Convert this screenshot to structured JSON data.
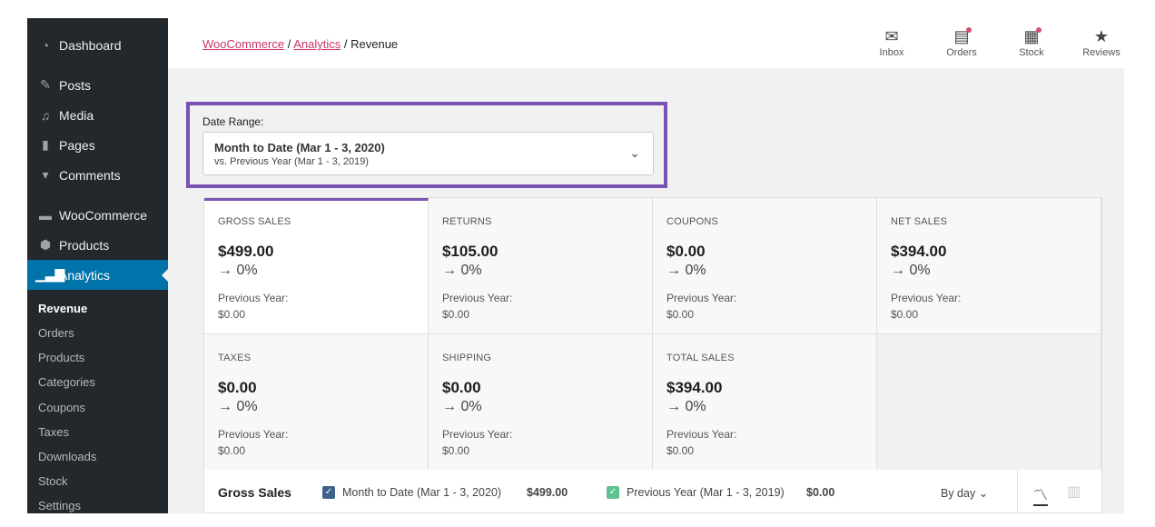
{
  "sidebar": {
    "menu": [
      {
        "label": "Dashboard",
        "icon": "dashboard-icon"
      },
      {
        "label": "Posts",
        "icon": "pin-icon"
      },
      {
        "label": "Media",
        "icon": "media-icon"
      },
      {
        "label": "Pages",
        "icon": "pages-icon"
      },
      {
        "label": "Comments",
        "icon": "comment-icon"
      },
      {
        "label": "WooCommerce",
        "icon": "woo-icon"
      },
      {
        "label": "Products",
        "icon": "box-icon"
      },
      {
        "label": "Analytics",
        "icon": "bar-chart-icon"
      }
    ],
    "submenu": [
      "Revenue",
      "Orders",
      "Products",
      "Categories",
      "Coupons",
      "Taxes",
      "Downloads",
      "Stock",
      "Settings"
    ]
  },
  "header": {
    "breadcrumb": [
      "WooCommerce",
      "Analytics",
      "Revenue"
    ],
    "sep": "/",
    "actions": [
      {
        "label": "Inbox",
        "icon": "inbox-icon"
      },
      {
        "label": "Orders",
        "icon": "orders-icon"
      },
      {
        "label": "Stock",
        "icon": "stock-icon"
      },
      {
        "label": "Reviews",
        "icon": "star-icon"
      }
    ]
  },
  "date_range": {
    "label": "Date Range:",
    "main": "Month to Date (Mar 1 - 3, 2020)",
    "compare": "vs. Previous Year (Mar 1 - 3, 2019)"
  },
  "cards": [
    {
      "label": "GROSS SALES",
      "value": "$499.00",
      "delta": "→ 0%",
      "prev_label": "Previous Year:",
      "prev": "$0.00"
    },
    {
      "label": "RETURNS",
      "value": "$105.00",
      "delta": "→ 0%",
      "prev_label": "Previous Year:",
      "prev": "$0.00"
    },
    {
      "label": "COUPONS",
      "value": "$0.00",
      "delta": "→ 0%",
      "prev_label": "Previous Year:",
      "prev": "$0.00"
    },
    {
      "label": "NET SALES",
      "value": "$394.00",
      "delta": "→ 0%",
      "prev_label": "Previous Year:",
      "prev": "$0.00"
    },
    {
      "label": "TAXES",
      "value": "$0.00",
      "delta": "→ 0%",
      "prev_label": "Previous Year:",
      "prev": "$0.00"
    },
    {
      "label": "SHIPPING",
      "value": "$0.00",
      "delta": "→ 0%",
      "prev_label": "Previous Year:",
      "prev": "$0.00"
    },
    {
      "label": "TOTAL SALES",
      "value": "$394.00",
      "delta": "→ 0%",
      "prev_label": "Previous Year:",
      "prev": "$0.00"
    }
  ],
  "chart": {
    "title": "Gross Sales",
    "legend": [
      {
        "label": "Month to Date (Mar 1 - 3, 2020)",
        "value": "$499.00",
        "color": "#3e6289"
      },
      {
        "label": "Previous Year (Mar 1 - 3, 2019)",
        "value": "$0.00",
        "color": "#5ec290"
      }
    ],
    "interval": "By day"
  },
  "colors": {
    "accent": "#7952b3",
    "link": "#c9356e",
    "sidebar": "#23282d",
    "active": "#0073aa"
  }
}
